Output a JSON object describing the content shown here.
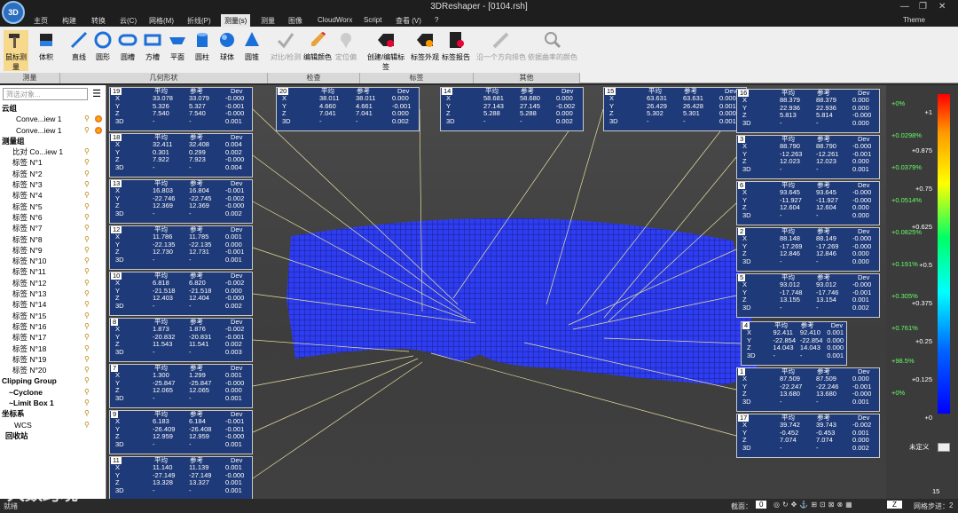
{
  "app": {
    "logo": "3D",
    "title": "3DReshaper - [0104.rsh]",
    "theme": "Theme"
  },
  "menu": [
    "主页",
    "构建",
    "转换",
    "云(C)",
    "网格(M)",
    "折线(P)",
    "测量(s)",
    "测量",
    "图像",
    "CloudWorx",
    "Script",
    "查看 (V)",
    "?"
  ],
  "ribbon": {
    "buttons": [
      "鼠标测量",
      "体积",
      "直线",
      "圆形",
      "圆槽",
      "方槽",
      "平面",
      "圆柱",
      "球体",
      "圆锥",
      "对比/检测",
      "编辑颜色",
      "定位偏",
      "创建/编辑标签",
      "标签外观",
      "标签报告",
      "沿一个方向排色",
      "依据曲率的颜色"
    ],
    "groups": [
      "测量",
      "几何形状",
      "检查",
      "标签",
      "其他"
    ]
  },
  "panel": {
    "search": "筛选对象...",
    "tree": [
      "云组",
      "Conve...iew 1",
      "Conve...iew 1",
      "测量组",
      "比对 Co...iew 1",
      "标签 N°1",
      "标签 N°2",
      "标签 N°3",
      "标签 N°4",
      "标签 N°5",
      "标签 N°6",
      "标签 N°7",
      "标签 N°8",
      "标签 N°9",
      "标签 N°10",
      "标签 N°11",
      "标签 N°12",
      "标签 N°13",
      "标签 N°14",
      "标签 N°15",
      "标签 N°16",
      "标签 N°17",
      "标签 N°18",
      "标签 N°19",
      "标签 N°20",
      "Clipping Group",
      "~Cyclone",
      "~Limit Box 1",
      "坐标系",
      "WCS",
      "回收站"
    ]
  },
  "table_header": [
    "平均",
    "参考",
    "Dev"
  ],
  "row_labels": [
    "X",
    "Y",
    "Z",
    "3D"
  ],
  "labels": [
    {
      "id": "19",
      "v": [
        [
          "33.078",
          "33.079",
          "-0.000"
        ],
        [
          "5.326",
          "5.327",
          "-0.001"
        ],
        [
          "7.540",
          "7.540",
          "-0.000"
        ],
        [
          "-",
          "-",
          "0.001"
        ]
      ]
    },
    {
      "id": "18",
      "v": [
        [
          "32.411",
          "32.408",
          "0.004"
        ],
        [
          "0.301",
          "0.299",
          "0.002"
        ],
        [
          "7.922",
          "7.923",
          "-0.000"
        ],
        [
          "-",
          "-",
          "0.004"
        ]
      ]
    },
    {
      "id": "13",
      "v": [
        [
          "16.803",
          "16.804",
          "-0.001"
        ],
        [
          "-22.746",
          "-22.745",
          "-0.002"
        ],
        [
          "12.369",
          "12.369",
          "-0.000"
        ],
        [
          "-",
          "-",
          "0.002"
        ]
      ]
    },
    {
      "id": "12",
      "v": [
        [
          "11.786",
          "11.785",
          "0.001"
        ],
        [
          "-22.135",
          "-22.135",
          "0.000"
        ],
        [
          "12.730",
          "12.731",
          "-0.001"
        ],
        [
          "-",
          "-",
          "0.001"
        ]
      ]
    },
    {
      "id": "10",
      "v": [
        [
          "6.818",
          "6.820",
          "-0.002"
        ],
        [
          "-21.518",
          "-21.518",
          "0.000"
        ],
        [
          "12.403",
          "12.404",
          "-0.000"
        ],
        [
          "-",
          "-",
          "0.002"
        ]
      ]
    },
    {
      "id": "8",
      "v": [
        [
          "1.873",
          "1.876",
          "-0.002"
        ],
        [
          "-20.832",
          "-20.831",
          "-0.001"
        ],
        [
          "11.543",
          "11.541",
          "0.002"
        ],
        [
          "-",
          "-",
          "0.003"
        ]
      ]
    },
    {
      "id": "7",
      "v": [
        [
          "1.300",
          "1.299",
          "0.001"
        ],
        [
          "-25.847",
          "-25.847",
          "-0.000"
        ],
        [
          "12.065",
          "12.065",
          "0.000"
        ],
        [
          "-",
          "-",
          "0.001"
        ]
      ]
    },
    {
      "id": "9",
      "v": [
        [
          "6.183",
          "6.184",
          "-0.001"
        ],
        [
          "-26.409",
          "-26.408",
          "-0.001"
        ],
        [
          "12.959",
          "12.959",
          "-0.000"
        ],
        [
          "-",
          "-",
          "0.001"
        ]
      ]
    },
    {
      "id": "11",
      "v": [
        [
          "11.140",
          "11.139",
          "0.001"
        ],
        [
          "-27.149",
          "-27.149",
          "-0.000"
        ],
        [
          "13.328",
          "13.327",
          "0.001"
        ],
        [
          "-",
          "-",
          "0.001"
        ]
      ]
    },
    {
      "id": "20",
      "v": [
        [
          "38.011",
          "38.011",
          "0.000"
        ],
        [
          "4.660",
          "4.661",
          "-0.001"
        ],
        [
          "7.041",
          "7.041",
          "0.000"
        ],
        [
          "-",
          "-",
          "0.002"
        ]
      ]
    },
    {
      "id": "14",
      "v": [
        [
          "58.681",
          "58.680",
          "0.000"
        ],
        [
          "27.143",
          "27.145",
          "-0.002"
        ],
        [
          "5.288",
          "5.288",
          "0.000"
        ],
        [
          "-",
          "-",
          "0.002"
        ]
      ]
    },
    {
      "id": "15",
      "v": [
        [
          "63.631",
          "63.631",
          "0.000"
        ],
        [
          "26.429",
          "26.428",
          "0.001"
        ],
        [
          "5.302",
          "5.301",
          "0.000"
        ],
        [
          "-",
          "-",
          "0.001"
        ]
      ]
    },
    {
      "id": "16",
      "v": [
        [
          "88.379",
          "88.379",
          "0.000"
        ],
        [
          "22.936",
          "22.936",
          "0.000"
        ],
        [
          "5.813",
          "5.814",
          "-0.000"
        ],
        [
          "-",
          "-",
          "0.000"
        ]
      ]
    },
    {
      "id": "3",
      "v": [
        [
          "88.790",
          "88.790",
          "-0.000"
        ],
        [
          "-12.263",
          "-12.261",
          "-0.001"
        ],
        [
          "12.023",
          "12.023",
          "0.000"
        ],
        [
          "-",
          "-",
          "0.001"
        ]
      ]
    },
    {
      "id": "6",
      "v": [
        [
          "93.645",
          "93.645",
          "-0.000"
        ],
        [
          "-11.927",
          "-11.927",
          "-0.000"
        ],
        [
          "12.604",
          "12.604",
          "0.000"
        ],
        [
          "-",
          "-",
          "0.000"
        ]
      ]
    },
    {
      "id": "2",
      "v": [
        [
          "88.148",
          "88.149",
          "-0.000"
        ],
        [
          "-17.269",
          "-17.269",
          "-0.000"
        ],
        [
          "12.846",
          "12.846",
          "0.000"
        ],
        [
          "-",
          "-",
          "0.000"
        ]
      ]
    },
    {
      "id": "5",
      "v": [
        [
          "93.012",
          "93.012",
          "-0.000"
        ],
        [
          "-17.748",
          "-17.746",
          "-0.001"
        ],
        [
          "13.155",
          "13.154",
          "0.001"
        ],
        [
          "-",
          "-",
          "0.002"
        ]
      ]
    },
    {
      "id": "4",
      "v": [
        [
          "92.411",
          "92.410",
          "0.001"
        ],
        [
          "-22.854",
          "-22.854",
          "0.000"
        ],
        [
          "14.043",
          "14.043",
          "0.000"
        ],
        [
          "-",
          "-",
          "0.001"
        ]
      ]
    },
    {
      "id": "1",
      "v": [
        [
          "87.509",
          "87.509",
          "0.000"
        ],
        [
          "-22.247",
          "-22.246",
          "-0.001"
        ],
        [
          "13.680",
          "13.680",
          "-0.000"
        ],
        [
          "-",
          "-",
          "0.001"
        ]
      ]
    },
    {
      "id": "17",
      "v": [
        [
          "39.742",
          "39.743",
          "-0.002"
        ],
        [
          "-0.452",
          "-0.453",
          "0.001"
        ],
        [
          "7.074",
          "7.074",
          "0.000"
        ],
        [
          "-",
          "-",
          "0.002"
        ]
      ]
    }
  ],
  "colorbar": {
    "pct": [
      "+0%",
      "+0.0298%",
      "+0.0379%",
      "+0.0514%",
      "+0.0825%",
      "+0.191%",
      "+0.305%",
      "+0.761%",
      "+98.5%",
      "+0%"
    ],
    "ticks": [
      "+1",
      "+0.875",
      "+0.75",
      "+0.625",
      "+0.5",
      "+0.375",
      "+0.25",
      "+0.125",
      "+0"
    ],
    "undef": "未定义",
    "foot": "15"
  },
  "status": {
    "left": "就绪",
    "section_label": "截面：",
    "section_value": "0",
    "step_label": "网格步进：",
    "step_value": "2",
    "axis": "Z"
  },
  "watermark": "大数跨境"
}
